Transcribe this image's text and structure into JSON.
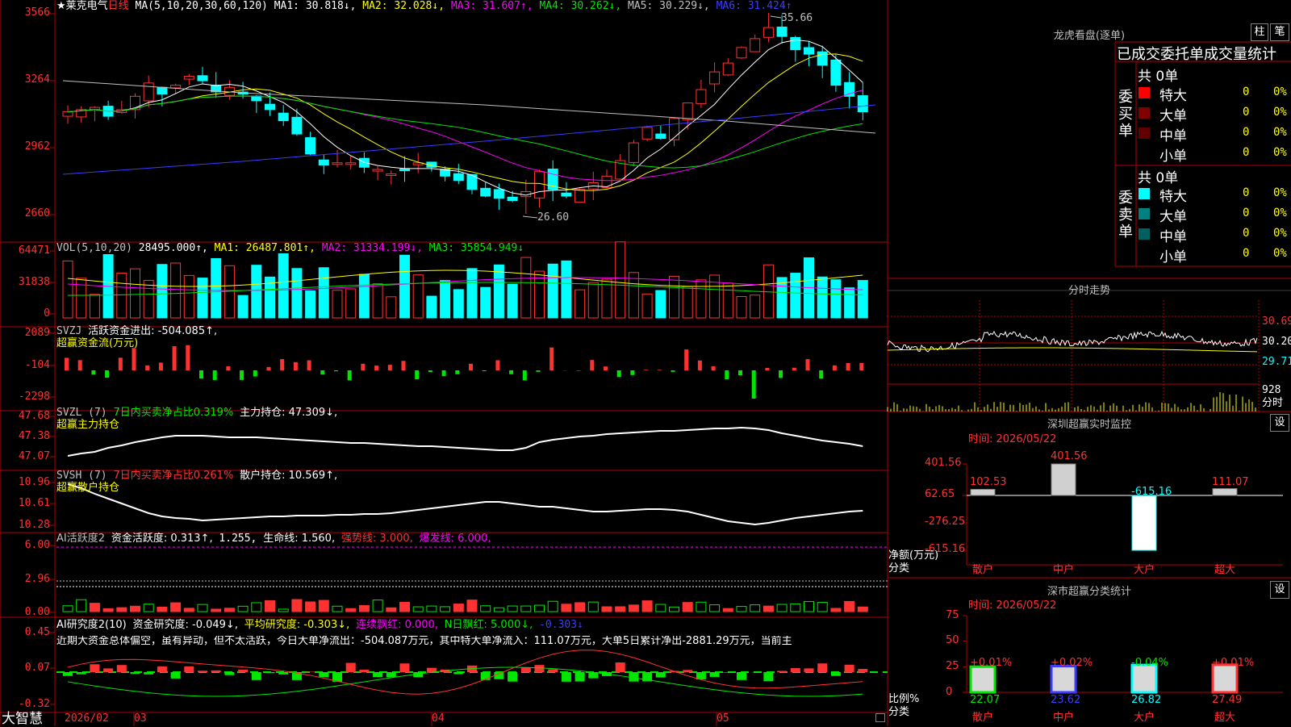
{
  "colors": {
    "up": "#ff3232",
    "down": "#00ffff",
    "ma1": "#ffffff",
    "ma2": "#ffff00",
    "ma3": "#ff00ff",
    "ma4": "#00e600",
    "ma5": "#c0c0c0",
    "ma6": "#3c3cff",
    "grid": "#b00000"
  },
  "kline": {
    "stock_name": "★莱克电气",
    "period": "日线",
    "ma_header": "MA(5,10,20,30,60,120)",
    "ma1": "MA1: 30.818↓,",
    "ma2": "MA2: 32.028↓,",
    "ma3": "MA3: 31.607↑,",
    "ma4": "MA4: 30.262↓,",
    "ma5": "MA5: 30.229↓,",
    "ma6": "MA6: 31.424↑",
    "high_label": "35.66",
    "low_label": "26.60",
    "y_ticks": [
      "3566",
      "3264",
      "2962",
      "2660"
    ]
  },
  "vol": {
    "header": "VOL(5,10,20)",
    "value": "28495.000↑,",
    "ma1": "MA1: 26487.801↑,",
    "ma2": "MA2: 31334.199↓,",
    "ma3": "MA3: 35854.949↓",
    "y_ticks": [
      "64471",
      "31838",
      "0"
    ]
  },
  "svzj": {
    "header": "SVZJ",
    "item": "活跃资金进出: -504.085↑,",
    "sub": "超赢资金流(万元)",
    "y_ticks": [
      "2089",
      "-104",
      "-2298"
    ]
  },
  "svzl": {
    "header": "SVZL (7)",
    "item1": "7日内买卖净占比0.319%",
    "item2": "主力持仓: 47.309↓,",
    "sub": "超赢主力持仓",
    "y_ticks": [
      "47.68",
      "47.38",
      "47.07"
    ]
  },
  "svsh": {
    "header": "SVSH (7)",
    "item1": "7日内买卖净占比0.261%",
    "item2": "散户持仓: 10.569↑,",
    "sub": "超赢散户持仓",
    "y_ticks": [
      "10.96",
      "10.61",
      "10.28"
    ]
  },
  "ai1": {
    "header": "AI活跃度2",
    "item1": "资金活跃度: 0.313↑,",
    "item2": "1.255,",
    "item3": "生命线: 1.560,",
    "item4": "强势线: 3.000,",
    "item5": "爆发线: 6.000,",
    "y_ticks": [
      "6.00",
      "2.96",
      "0.00"
    ]
  },
  "ai2": {
    "header": "AI研究度2(10)",
    "item1": "资金研究度: -0.049↓,",
    "item2": "平均研究度: -0.303↓,",
    "item3": "连续飘红: 0.000,",
    "item4": "N日飘红: 5.000↓,",
    "item5": "-0.303↓",
    "commentary": "近期大资金总体偏空，虽有异动，但不太活跃，今日大单净流出：-504.087万元，其中特大单净流入：111.07万元，大单5日累计净出-2881.29万元，当前主",
    "y_ticks": [
      "0.45",
      "0.07",
      "-0.32"
    ]
  },
  "xaxis": {
    "brand": "大智慧",
    "labels": [
      "2026/02",
      "03",
      "04",
      "05"
    ]
  },
  "dragon": {
    "title": "龙虎看盘(逐单)",
    "btn1": "柱",
    "btn2": "笔",
    "header": "已成交委托单成交量统计",
    "buy_label": "委买单",
    "sell_label": "委卖单",
    "buy_total": "共 0单",
    "sell_total": "共 0单",
    "buy_rows": [
      {
        "name": "特大",
        "count": "0",
        "pct": "0%",
        "color": "#ff0000"
      },
      {
        "name": "大单",
        "count": "0",
        "pct": "0%",
        "color": "#800000"
      },
      {
        "name": "中单",
        "count": "0",
        "pct": "0%",
        "color": "#600000"
      },
      {
        "name": "小单",
        "count": "0",
        "pct": "0%",
        "color": "#000000"
      }
    ],
    "sell_rows": [
      {
        "name": "特大",
        "count": "0",
        "pct": "0%",
        "color": "#00ffff"
      },
      {
        "name": "大单",
        "count": "0",
        "pct": "0%",
        "color": "#008080"
      },
      {
        "name": "中单",
        "count": "0",
        "pct": "0%",
        "color": "#006060"
      },
      {
        "name": "小单",
        "count": "0",
        "pct": "0%",
        "color": "#000000"
      }
    ]
  },
  "intraday": {
    "title": "分时走势",
    "price_ticks": [
      "30.69",
      "30.20",
      "29.71"
    ],
    "vol_tick": "928",
    "vol_unit": "分时"
  },
  "monitor": {
    "title": "深圳超赢实时监控",
    "btn": "设",
    "time": "时间: 2026/05/22",
    "y_ticks": [
      "401.56",
      "62.65",
      "-276.25",
      "-615.16"
    ],
    "unit1": "净额(万元)",
    "unit2": "分类",
    "categories": [
      "散户",
      "中户",
      "大户",
      "超大"
    ],
    "values": [
      102.53,
      401.56,
      -615.16,
      111.07
    ],
    "value_labels": [
      "102.53",
      "401.56",
      "-615.16",
      "111.07"
    ]
  },
  "classify": {
    "title": "深市超赢分类统计",
    "btn": "设",
    "time": "时间: 2026/05/22",
    "y_ticks": [
      "75",
      "50",
      "25",
      "0"
    ],
    "unit1": "比例%",
    "unit2": "分类",
    "categories": [
      "散户",
      "中户",
      "大户",
      "超大"
    ],
    "values": [
      22.07,
      23.62,
      26.82,
      27.49
    ],
    "value_labels": [
      "22.07",
      "23.62",
      "26.82",
      "27.49"
    ],
    "change_labels": [
      "+0.01%",
      "+0.02%",
      "-0.04%",
      "+0.01%"
    ]
  }
}
